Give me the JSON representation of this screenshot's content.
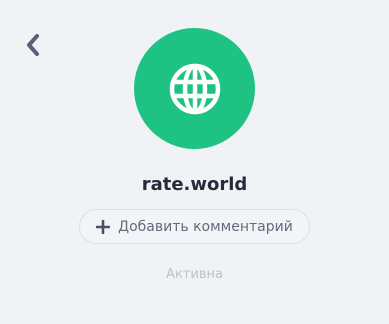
{
  "site": {
    "name": "rate.world",
    "avatar_color": "#1ec282",
    "icon": "globe-icon"
  },
  "actions": {
    "add_comment_label": "Добавить комментарий"
  },
  "status": {
    "text": "Активна"
  },
  "navigation": {
    "back_icon": "chevron-left-icon"
  }
}
